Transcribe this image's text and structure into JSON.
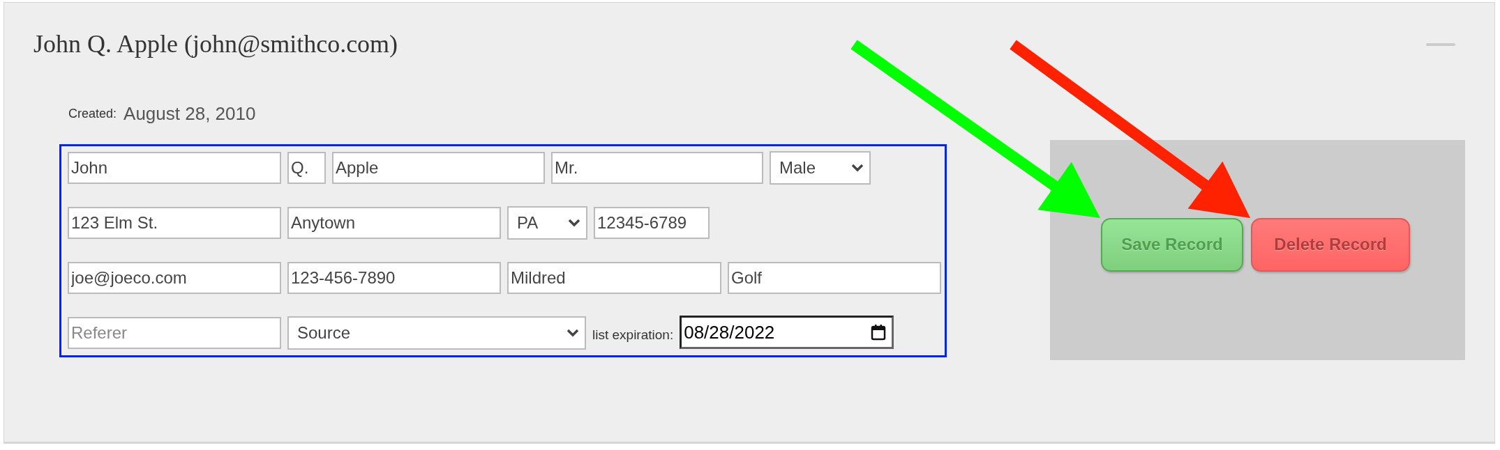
{
  "record": {
    "title": "John Q. Apple (john@smithco.com)",
    "created_label": "Created:",
    "created_date": "August 28, 2010"
  },
  "form_rows": [
    [
      {
        "kind": "input",
        "value": "John"
      },
      {
        "kind": "input",
        "value": "Q."
      },
      {
        "kind": "input",
        "value": "Apple"
      },
      {
        "kind": "input",
        "value": "Mr."
      },
      {
        "kind": "select",
        "value": "Male"
      }
    ],
    [
      {
        "kind": "input",
        "value": "123 Elm St."
      },
      {
        "kind": "input",
        "value": "Anytown"
      },
      {
        "kind": "select",
        "value": "PA"
      },
      {
        "kind": "input",
        "value": "12345-6789"
      }
    ],
    [
      {
        "kind": "input",
        "value": "joe@joeco.com"
      },
      {
        "kind": "input",
        "value": "123-456-7890"
      },
      {
        "kind": "input",
        "value": "Mildred"
      },
      {
        "kind": "input",
        "value": "Golf"
      }
    ],
    [
      {
        "kind": "input",
        "placeholder": "Referer"
      },
      {
        "kind": "select",
        "value": "Source"
      },
      {
        "kind": "label",
        "text": "list expiration:"
      },
      {
        "kind": "date",
        "value": "08/28/2022"
      }
    ]
  ],
  "buttons": [
    {
      "kind": "save",
      "label": "Save Record"
    },
    {
      "kind": "delete",
      "label": "Delete Record"
    }
  ],
  "annotations": [
    {
      "kind": "arrow",
      "color": "#00ff00"
    },
    {
      "kind": "arrow",
      "color": "#ff2200"
    }
  ]
}
